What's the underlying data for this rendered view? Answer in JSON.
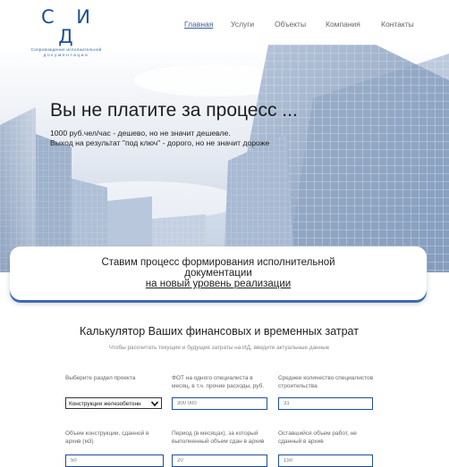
{
  "header": {
    "logo_mark": "С И Д",
    "logo_tagline_1": "Сопровождение исполнительной",
    "logo_tagline_2": "документации",
    "nav": [
      {
        "label": "Главная",
        "active": true
      },
      {
        "label": "Услуги",
        "active": false
      },
      {
        "label": "Объекты",
        "active": false
      },
      {
        "label": "Компания",
        "active": false
      },
      {
        "label": "Контакты",
        "active": false
      }
    ]
  },
  "hero": {
    "title": "Вы не платите за процесс ...",
    "line_1": "1000 руб.чел/час - дешево, но не значит дешевле.",
    "line_2": "Выход на результат \"под ключ\" - дорого, но не значит дороже"
  },
  "banner": {
    "line_1": "Ставим процесс формирования исполнительной",
    "line_2": "документации",
    "link": "на новый уровень реализации"
  },
  "calculator": {
    "title": "Калькулятор Ваших финансовых и временных затрат",
    "subtitle": "Чтобы рассчитать текущие и будущие затраты на ИД, введите актуальные данные",
    "fields": [
      {
        "label": "Выберите раздел проекта",
        "value": "Конструкции железобетонн"
      },
      {
        "label": "ФОТ на одного специалиста в месяц, в т.ч. прочие расходы, руб.",
        "placeholder": "300 000"
      },
      {
        "label": "Среднее количество специалистов строительства",
        "placeholder": "31"
      },
      {
        "label": "Объем конструкции, сданной в архив (м3)",
        "placeholder": "50"
      },
      {
        "label": "Период (в месяцах), за который выполненный объем сдан в архив",
        "placeholder": "20"
      },
      {
        "label": "Оставшийся объем работ, не сданный в архив",
        "placeholder": "150"
      }
    ]
  },
  "colors": {
    "brand": "#1e4f93",
    "banner_shadow": "#3d6ab0"
  }
}
